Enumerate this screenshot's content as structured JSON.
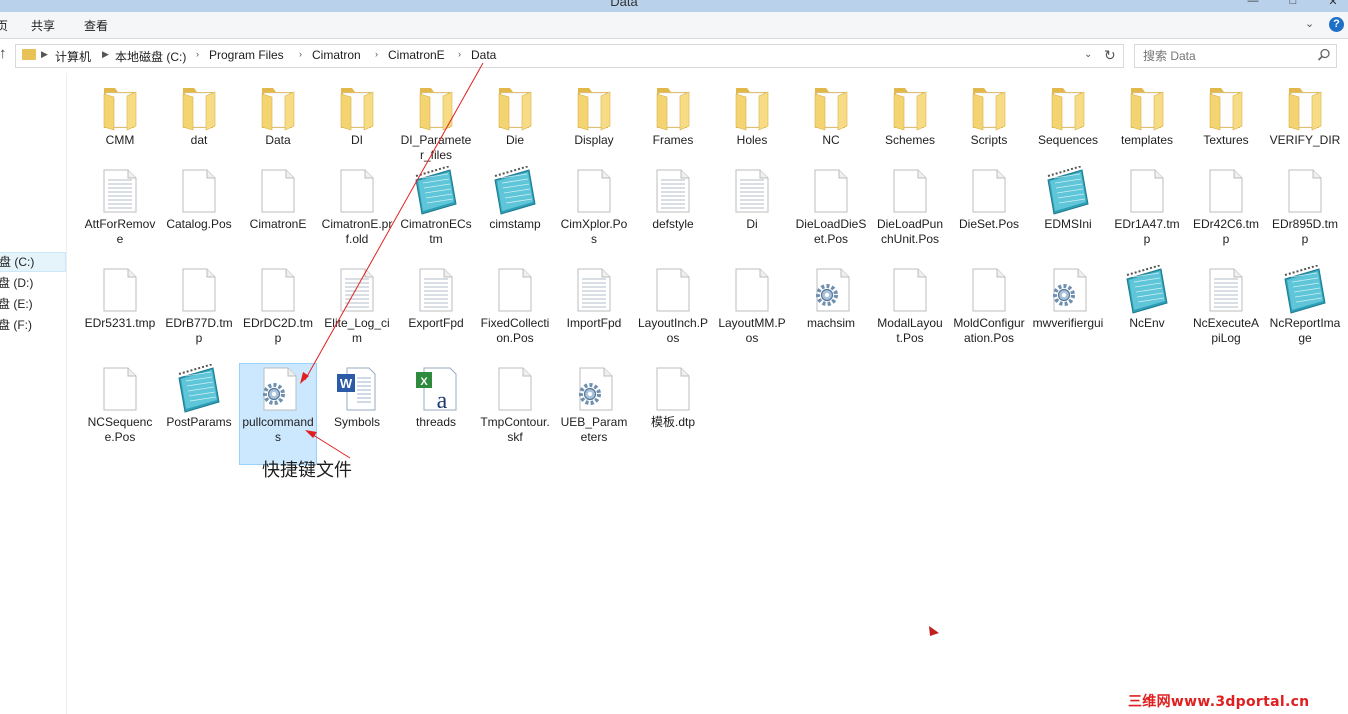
{
  "window": {
    "title": "Data"
  },
  "ribbon": {
    "tabs": [
      "",
      "共享",
      "查看"
    ],
    "partial_tab": "页"
  },
  "address": {
    "crumbs": [
      "计算机",
      "本地磁盘 (C:)",
      "Program Files",
      "Cimatron",
      "CimatronE",
      "Data"
    ]
  },
  "search": {
    "placeholder": "搜索 Data"
  },
  "nav": {
    "drives": [
      {
        "label": "盘 (C:)",
        "selected": true
      },
      {
        "label": "盘 (D:)",
        "selected": false
      },
      {
        "label": "盘 (E:)",
        "selected": false
      },
      {
        "label": "盘 (F:)",
        "selected": false
      }
    ]
  },
  "files": [
    {
      "name": "CMM",
      "type": "folder"
    },
    {
      "name": "dat",
      "type": "folder"
    },
    {
      "name": "Data",
      "type": "folder"
    },
    {
      "name": "DI",
      "type": "folder"
    },
    {
      "name": "DI_Parameter_files",
      "type": "folder"
    },
    {
      "name": "Die",
      "type": "folder"
    },
    {
      "name": "Display",
      "type": "folder"
    },
    {
      "name": "Frames",
      "type": "folder"
    },
    {
      "name": "Holes",
      "type": "folder"
    },
    {
      "name": "NC",
      "type": "folder"
    },
    {
      "name": "Schemes",
      "type": "folder"
    },
    {
      "name": "Scripts",
      "type": "folder"
    },
    {
      "name": "Sequences",
      "type": "folder"
    },
    {
      "name": "templates",
      "type": "folder"
    },
    {
      "name": "Textures",
      "type": "folder"
    },
    {
      "name": "VERIFY_DIR",
      "type": "folder"
    },
    {
      "name": "AttForRemove",
      "type": "text"
    },
    {
      "name": "Catalog.Pos",
      "type": "blank"
    },
    {
      "name": "CimatronE",
      "type": "blank"
    },
    {
      "name": "CimatronE.prf.old",
      "type": "blank"
    },
    {
      "name": "CimatronECstm",
      "type": "notepad"
    },
    {
      "name": "cimstamp",
      "type": "notepad"
    },
    {
      "name": "CimXplor.Pos",
      "type": "blank"
    },
    {
      "name": "defstyle",
      "type": "text"
    },
    {
      "name": "Di",
      "type": "text"
    },
    {
      "name": "DieLoadDieSet.Pos",
      "type": "blank"
    },
    {
      "name": "DieLoadPunchUnit.Pos",
      "type": "blank"
    },
    {
      "name": "DieSet.Pos",
      "type": "blank"
    },
    {
      "name": "EDMSIni",
      "type": "notepad"
    },
    {
      "name": "EDr1A47.tmp",
      "type": "blank"
    },
    {
      "name": "EDr42C6.tmp",
      "type": "blank"
    },
    {
      "name": "EDr895D.tmp",
      "type": "blank"
    },
    {
      "name": "EDr5231.tmp",
      "type": "blank"
    },
    {
      "name": "EDrB77D.tmp",
      "type": "blank"
    },
    {
      "name": "EDrDC2D.tmp",
      "type": "blank"
    },
    {
      "name": "Elite_Log_cim",
      "type": "text"
    },
    {
      "name": "ExportFpd",
      "type": "text"
    },
    {
      "name": "FixedCollection.Pos",
      "type": "blank"
    },
    {
      "name": "ImportFpd",
      "type": "text"
    },
    {
      "name": "LayoutInch.Pos",
      "type": "blank"
    },
    {
      "name": "LayoutMM.Pos",
      "type": "blank"
    },
    {
      "name": "machsim",
      "type": "gear"
    },
    {
      "name": "ModalLayout.Pos",
      "type": "blank"
    },
    {
      "name": "MoldConfiguration.Pos",
      "type": "blank"
    },
    {
      "name": "mwverifiergui",
      "type": "gear"
    },
    {
      "name": "NcEnv",
      "type": "notepad"
    },
    {
      "name": "NcExecuteApiLog",
      "type": "text"
    },
    {
      "name": "NcReportImage",
      "type": "notepad"
    },
    {
      "name": "NCSequence.Pos",
      "type": "blank"
    },
    {
      "name": "PostParams",
      "type": "notepad"
    },
    {
      "name": "pullcommands",
      "type": "gear",
      "selected": true
    },
    {
      "name": "Symbols",
      "type": "word"
    },
    {
      "name": "threads",
      "type": "font"
    },
    {
      "name": "TmpContour.skf",
      "type": "blank"
    },
    {
      "name": "UEB_Parameters",
      "type": "gear"
    },
    {
      "name": "模板.dtp",
      "type": "blank"
    }
  ],
  "annotation": {
    "text": "快捷键文件"
  },
  "watermark": {
    "text": "三维网www.3dportal.cn"
  },
  "colors": {
    "folder": "#f3d470",
    "selection_bg": "#cce8ff",
    "arrow": "#e02020",
    "titlebar": "#b9d1ea"
  }
}
